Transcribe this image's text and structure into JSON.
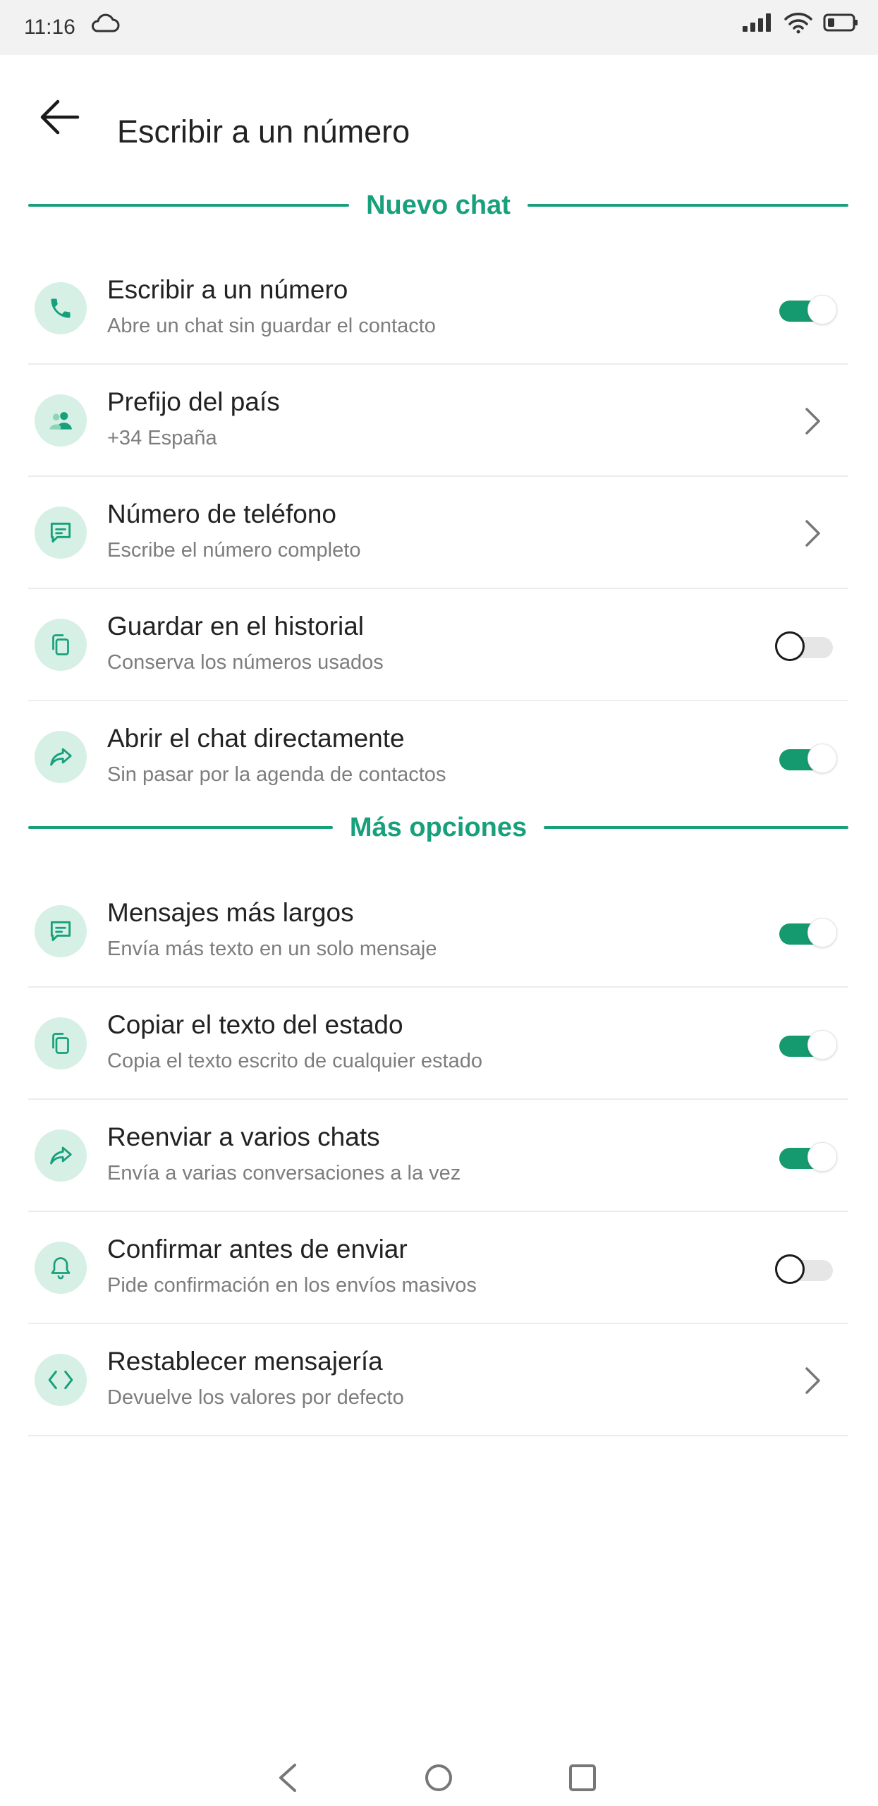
{
  "status_bar": {
    "time": "11:16",
    "cloud_icon": "cloud-icon",
    "signal_icon": "signal-icon",
    "wifi_icon": "wifi-icon",
    "battery_icon": "battery-icon"
  },
  "header": {
    "title": "Escribir a un número",
    "back_icon": "back-arrow-icon"
  },
  "colors": {
    "accent": "#17a07b",
    "toggle_on": "#15996f",
    "icon_bg": "#d6f0e6"
  },
  "sections": [
    {
      "title": "Nuevo chat",
      "items": [
        {
          "icon": "phone-icon",
          "title": "Escribir a un número",
          "subtitle": "Abre un chat sin guardar el contacto",
          "control": "toggle",
          "on": true
        },
        {
          "icon": "people-icon",
          "title": "Prefijo del país",
          "subtitle": "+34 España",
          "control": "chevron"
        },
        {
          "icon": "message-icon",
          "title": "Número de teléfono",
          "subtitle": "Escribe el número completo",
          "control": "chevron"
        },
        {
          "icon": "copy-icon",
          "title": "Guardar en el historial",
          "subtitle": "Conserva los números usados",
          "control": "toggle",
          "on": false
        },
        {
          "icon": "share-icon",
          "title": "Abrir el chat directamente",
          "subtitle": "Sin pasar por la agenda de contactos",
          "control": "toggle",
          "on": true
        }
      ]
    },
    {
      "title": "Más opciones",
      "items": [
        {
          "icon": "message-icon",
          "title": "Mensajes más largos",
          "subtitle": "Envía más texto en un solo mensaje",
          "control": "toggle",
          "on": true
        },
        {
          "icon": "copy-icon",
          "title": "Copiar el texto del estado",
          "subtitle": "Copia el texto escrito de cualquier estado",
          "control": "toggle",
          "on": true
        },
        {
          "icon": "share-icon",
          "title": "Reenviar a varios chats",
          "subtitle": "Envía a varias conversaciones a la vez",
          "control": "toggle",
          "on": true
        },
        {
          "icon": "bell-icon",
          "title": "Confirmar antes de enviar",
          "subtitle": "Pide confirmación en los envíos masivos",
          "control": "toggle",
          "on": false
        },
        {
          "icon": "code-icon",
          "title": "Restablecer mensajería",
          "subtitle": "Devuelve los valores por defecto",
          "control": "chevron"
        }
      ]
    }
  ],
  "nav_bar": {
    "back_icon": "nav-back-icon",
    "home_icon": "nav-home-icon",
    "recents_icon": "nav-recents-icon"
  }
}
